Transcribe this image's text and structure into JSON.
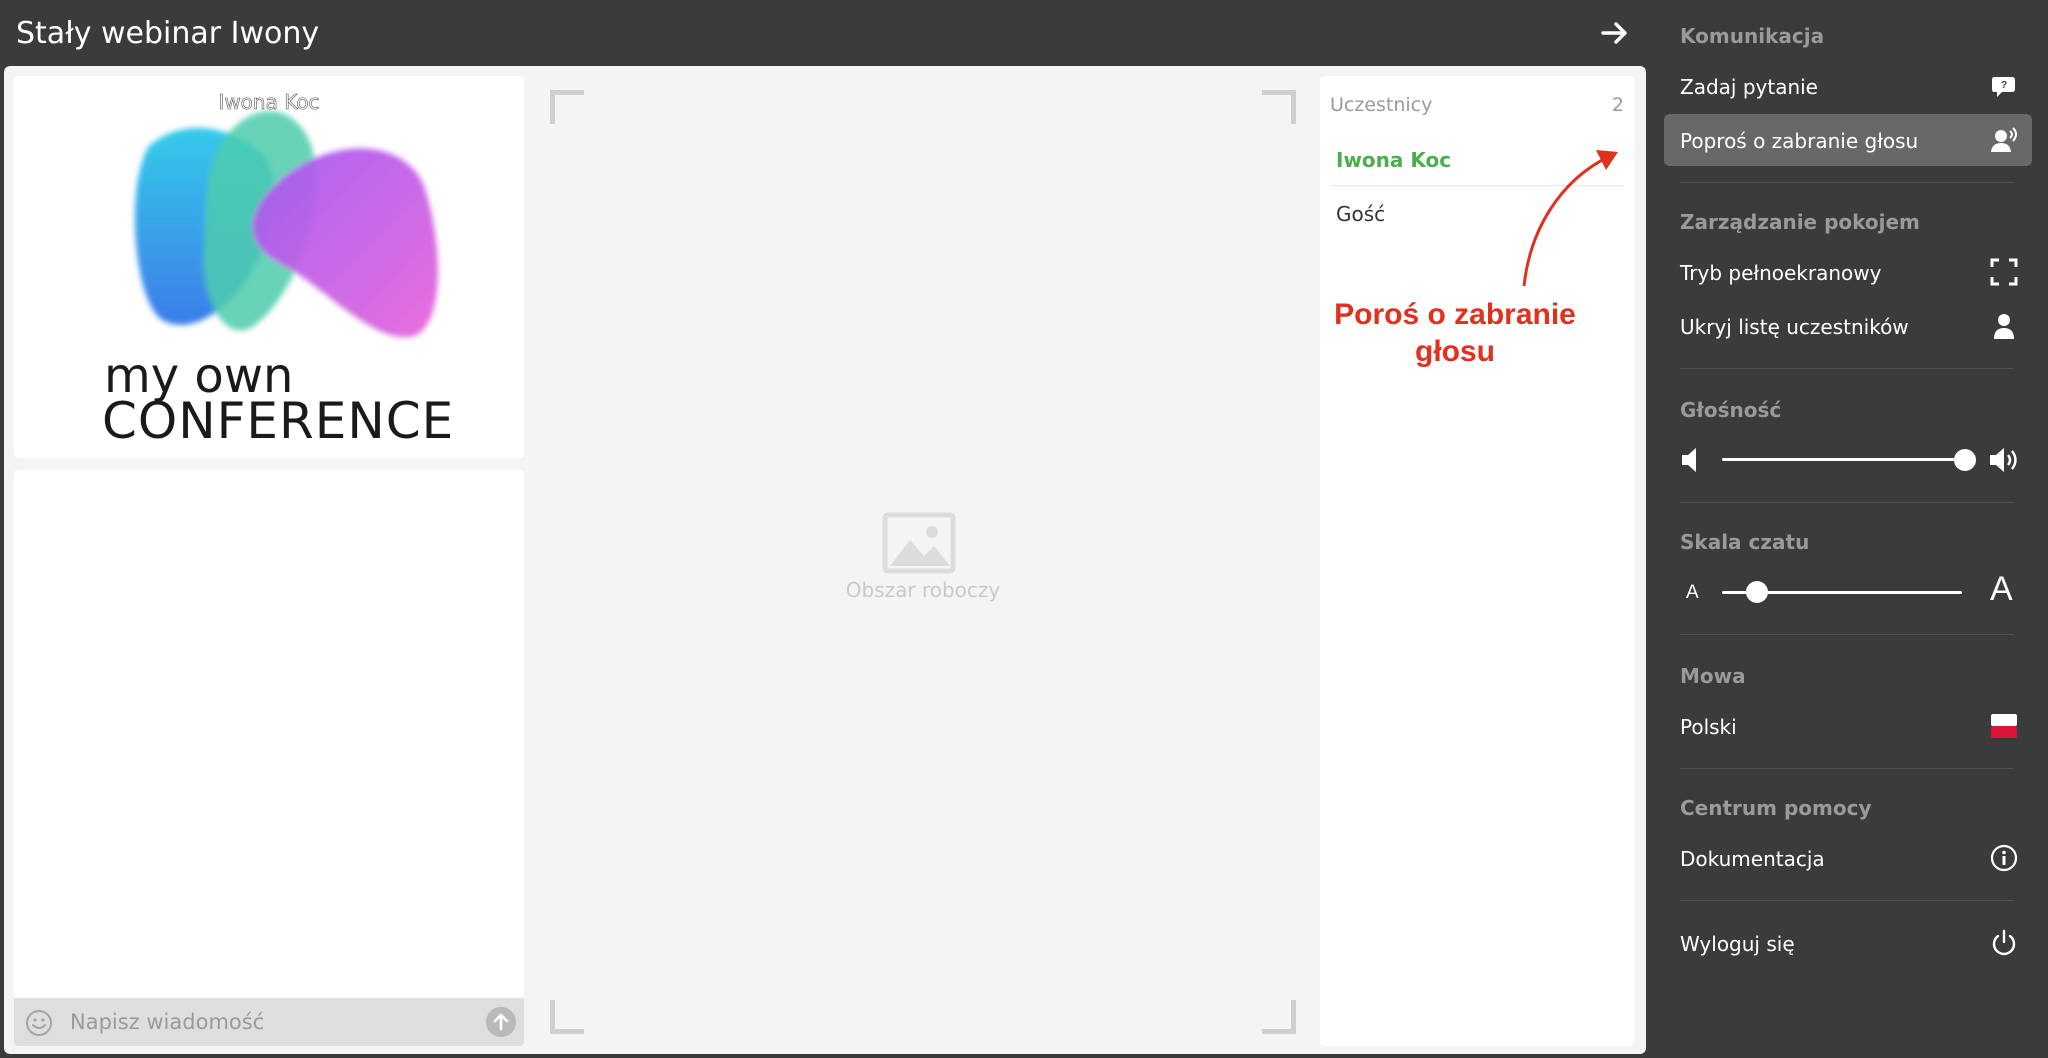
{
  "header": {
    "title": "Stały webinar Iwony"
  },
  "video": {
    "speaker_name": "Iwona Koc",
    "logo_line1": "my own",
    "logo_line2": "CONFERENCE"
  },
  "chat": {
    "placeholder": "Napisz wiadomość"
  },
  "workspace": {
    "label": "Obszar roboczy"
  },
  "participants": {
    "title": "Uczestnicy",
    "count": "2",
    "items": [
      {
        "name": "Iwona Koc",
        "role": "host"
      },
      {
        "name": "Gość",
        "role": "guest"
      }
    ]
  },
  "annotation": {
    "line1": "Poroś o zabranie",
    "line2": "głosu",
    "color": "#e0301e"
  },
  "sidebar": {
    "communication": {
      "title": "Komunikacja",
      "ask_question": "Zadaj pytanie",
      "request_speak": "Poproś o zabranie głosu"
    },
    "room": {
      "title": "Zarządzanie pokojem",
      "fullscreen": "Tryb pełnoekranowy",
      "hide_participants": "Ukryj listę uczestników"
    },
    "volume": {
      "title": "Głośność",
      "level": 1.0
    },
    "chat_scale": {
      "title": "Skala czatu",
      "small": "A",
      "large": "A",
      "level": 0.1
    },
    "speech": {
      "title": "Mowa",
      "language": "Polski"
    },
    "help": {
      "title": "Centrum pomocy",
      "docs": "Dokumentacja"
    },
    "logout": "Wyloguj się"
  },
  "colors": {
    "host_name": "#4cae4f",
    "sidebar_bg": "#393b3c",
    "active_item": "#66686a"
  }
}
